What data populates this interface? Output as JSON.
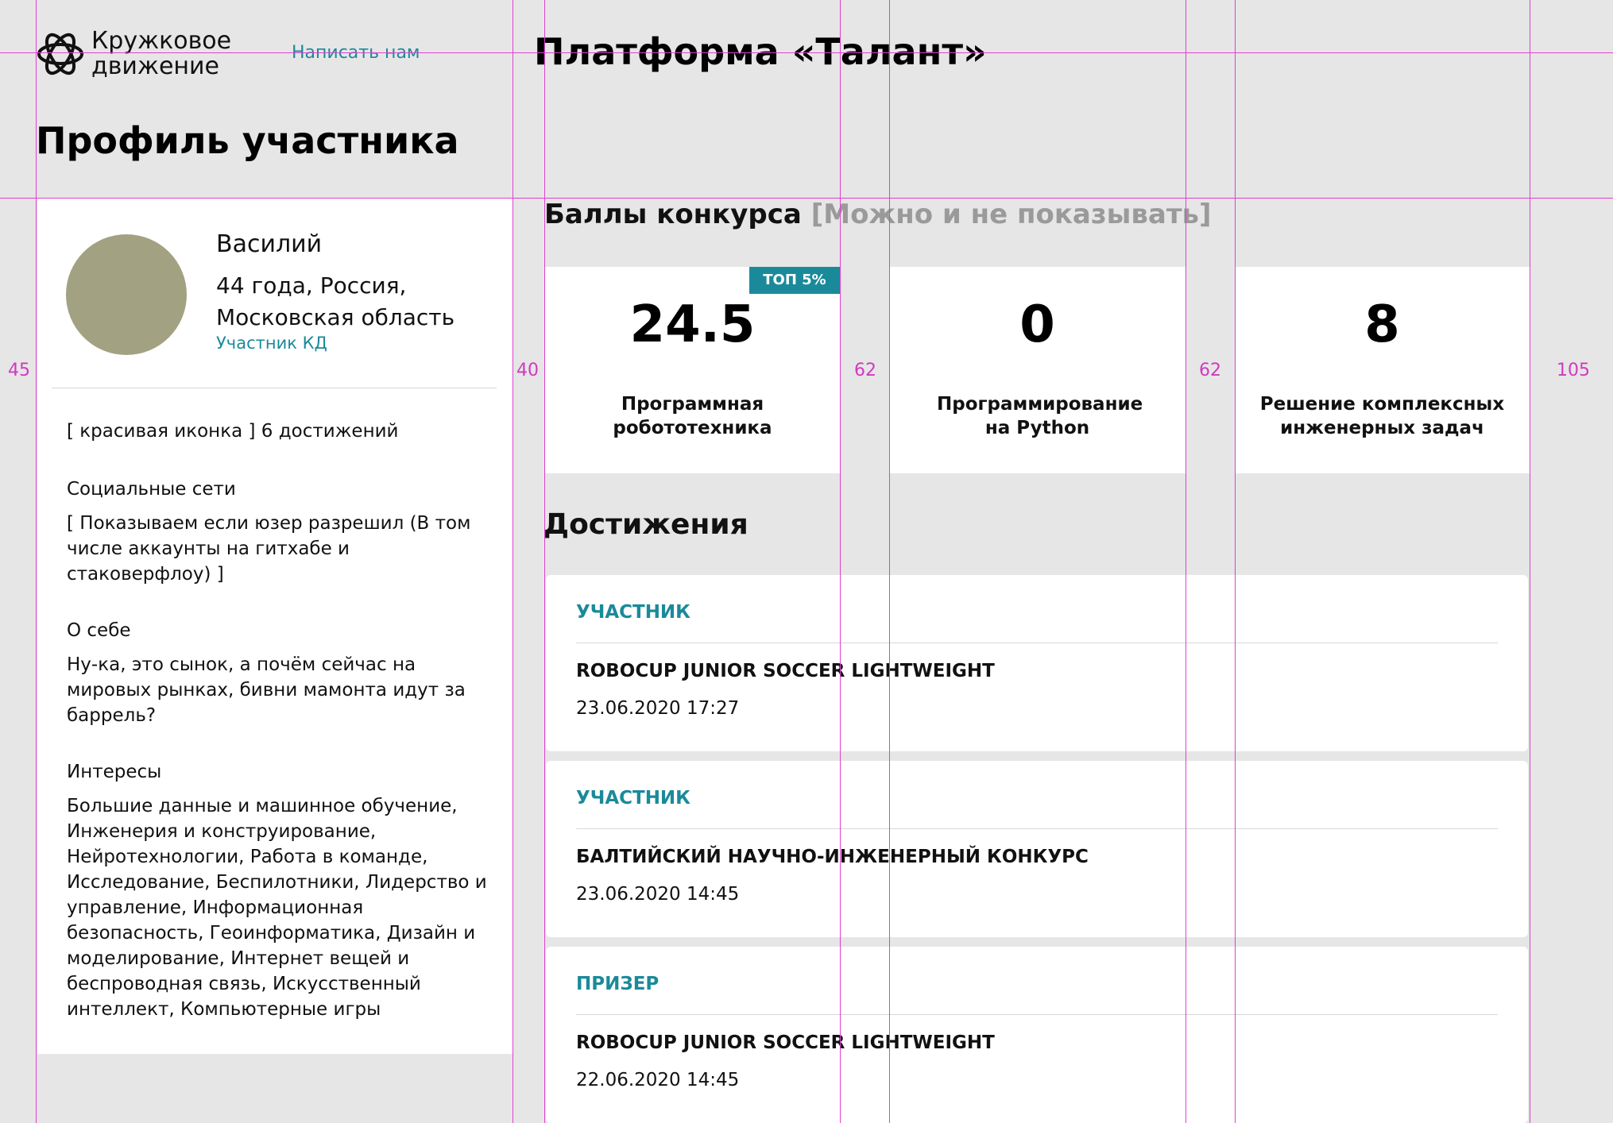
{
  "header": {
    "logo_line1": "Кружковое",
    "logo_line2": "движение",
    "contact_link": "Написать нам",
    "platform_title": "Платформа «Талант»"
  },
  "page_title": "Профиль участника",
  "profile": {
    "name": "Василий",
    "age_country": "44 года, Россия,",
    "region": "Московская область",
    "role": "Участник КД",
    "achievements_line": "[ красивая иконка ] 6 достижений",
    "social_heading": "Социальные сети",
    "social_text": "[ Показываем если юзер разрешил (В том числе аккаунты на гитхабе и стаковерфлоу) ]",
    "about_heading": "О себе",
    "about_text": "Ну-ка, это сынок, а почём сейчас на мировых рынках, бивни мамонта идут за баррель?",
    "interests_heading": "Интересы",
    "interests_text": "Большие данные и машинное обучение, Инженерия и конструирование, Нейротехнологии, Работа в команде, Исследование, Беспилотники, Лидерство и управление, Информационная безопасность, Геоинформатика, Дизайн и моделирование, Интернет вещей и беспроводная связь, Искусственный интеллект, Компьютерные игры"
  },
  "scores": {
    "title": "Баллы конкурса",
    "note": "[Можно и не показывать]",
    "items": [
      {
        "value": "24.5",
        "label": "Программная робототехника",
        "badge": "ТОП 5%"
      },
      {
        "value": "0",
        "label": "Программирование на Python"
      },
      {
        "value": "8",
        "label": "Решение комплексных инженерных задач"
      }
    ]
  },
  "achievements": {
    "title": "Достижения",
    "items": [
      {
        "status": "УЧАСТНИК",
        "name": "ROBOCUP JUNIOR SOCCER LIGHTWEIGHT",
        "date": "23.06.2020 17:27"
      },
      {
        "status": "УЧАСТНИК",
        "name": "БАЛТИЙСКИЙ НАУЧНО-ИНЖЕНЕРНЫЙ КОНКУРС",
        "date": "23.06.2020 14:45"
      },
      {
        "status": "ПРИЗЕР",
        "name": "ROBOCUP JUNIOR SOCCER LIGHTWEIGHT",
        "date": "22.06.2020 14:45"
      }
    ]
  },
  "guides": {
    "gap_left": "45",
    "gap_col": "40",
    "gap_card1": "62",
    "gap_card2": "62",
    "gap_right": "105"
  },
  "colors": {
    "accent": "#1a8a9a",
    "guide": "#e040d0",
    "avatar": "#a2a283",
    "background": "#e6e6e6"
  }
}
